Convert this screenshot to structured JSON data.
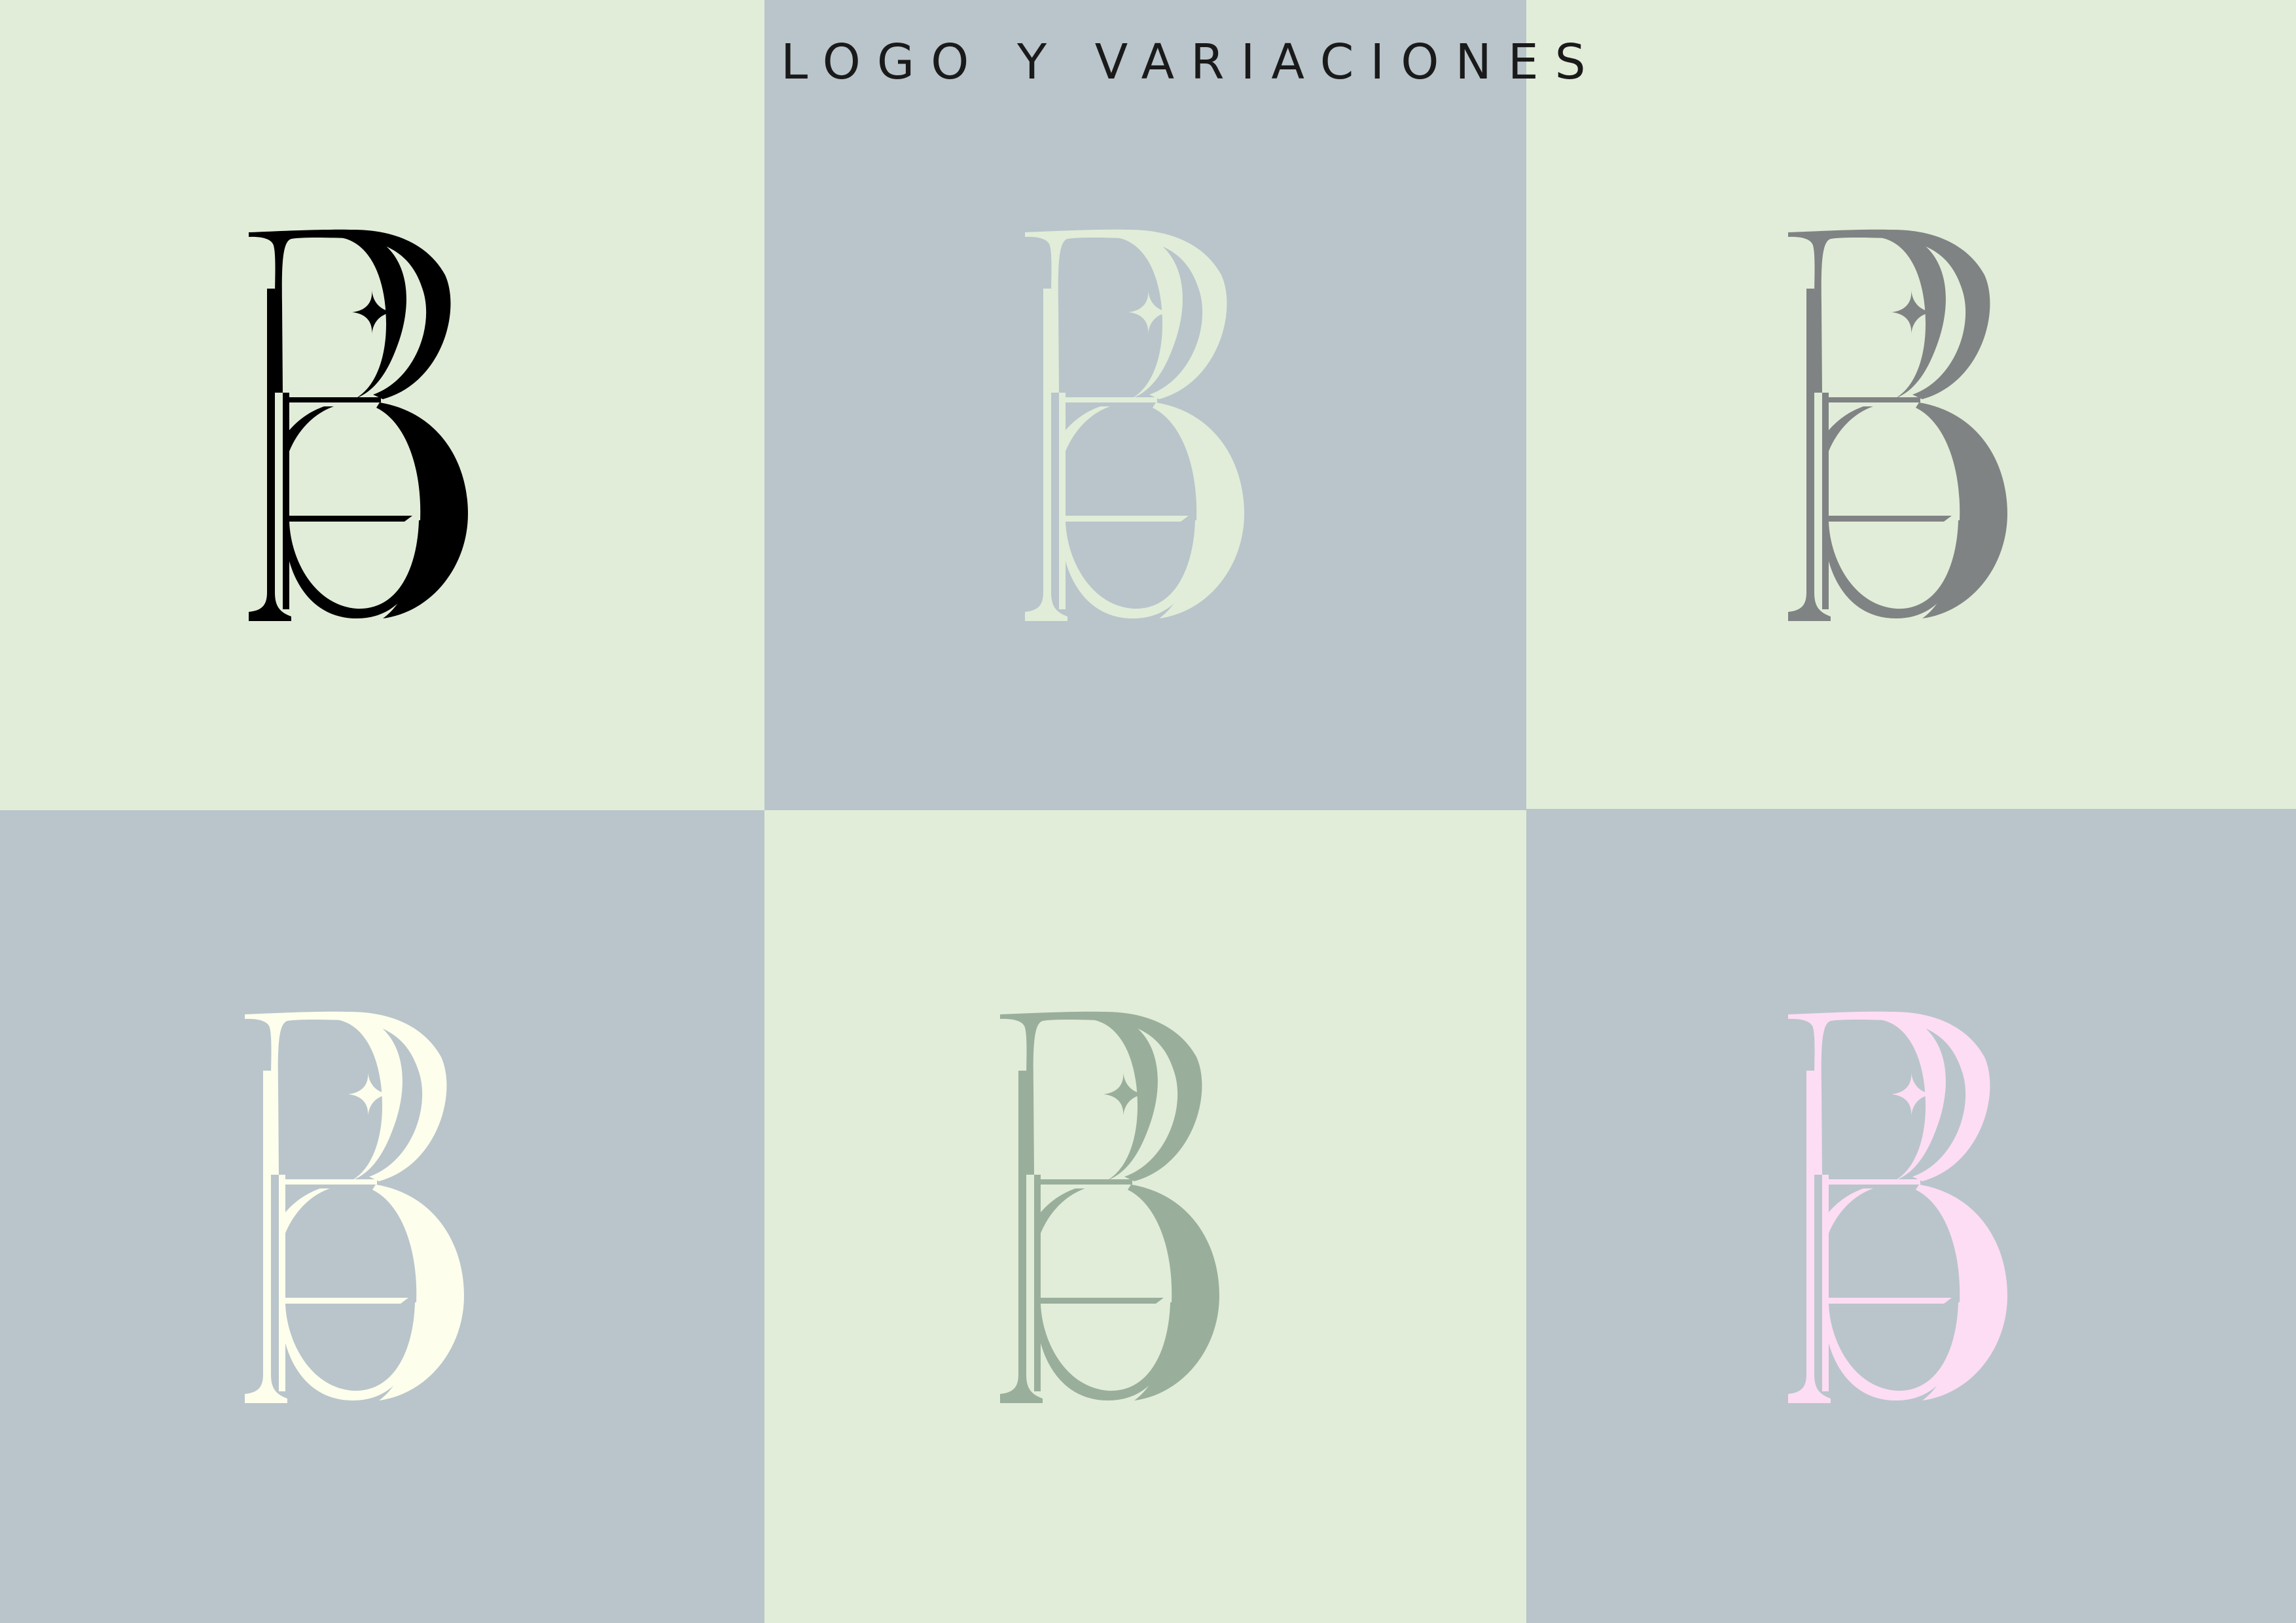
{
  "page_title": "LOGO Y VARIACIONES",
  "colors": {
    "background_green": "#e1edd8",
    "background_blue_gray": "#b9c5cb"
  },
  "variations": [
    {
      "name": "logo-black",
      "background": "#e1edd8",
      "color": "#000000"
    },
    {
      "name": "logo-light-green",
      "background": "#b9c5cb",
      "color": "#e1edd8"
    },
    {
      "name": "logo-gray",
      "background": "#e1edd8",
      "color": "#808384"
    },
    {
      "name": "logo-cream",
      "background": "#b9c5cb",
      "color": "#fdfeec"
    },
    {
      "name": "logo-sage",
      "background": "#e1edd8",
      "color": "#99af9b"
    },
    {
      "name": "logo-pink",
      "background": "#b9c5cb",
      "color": "#fdddf4"
    }
  ],
  "logo_icon": "eb-monogram-sparkle"
}
